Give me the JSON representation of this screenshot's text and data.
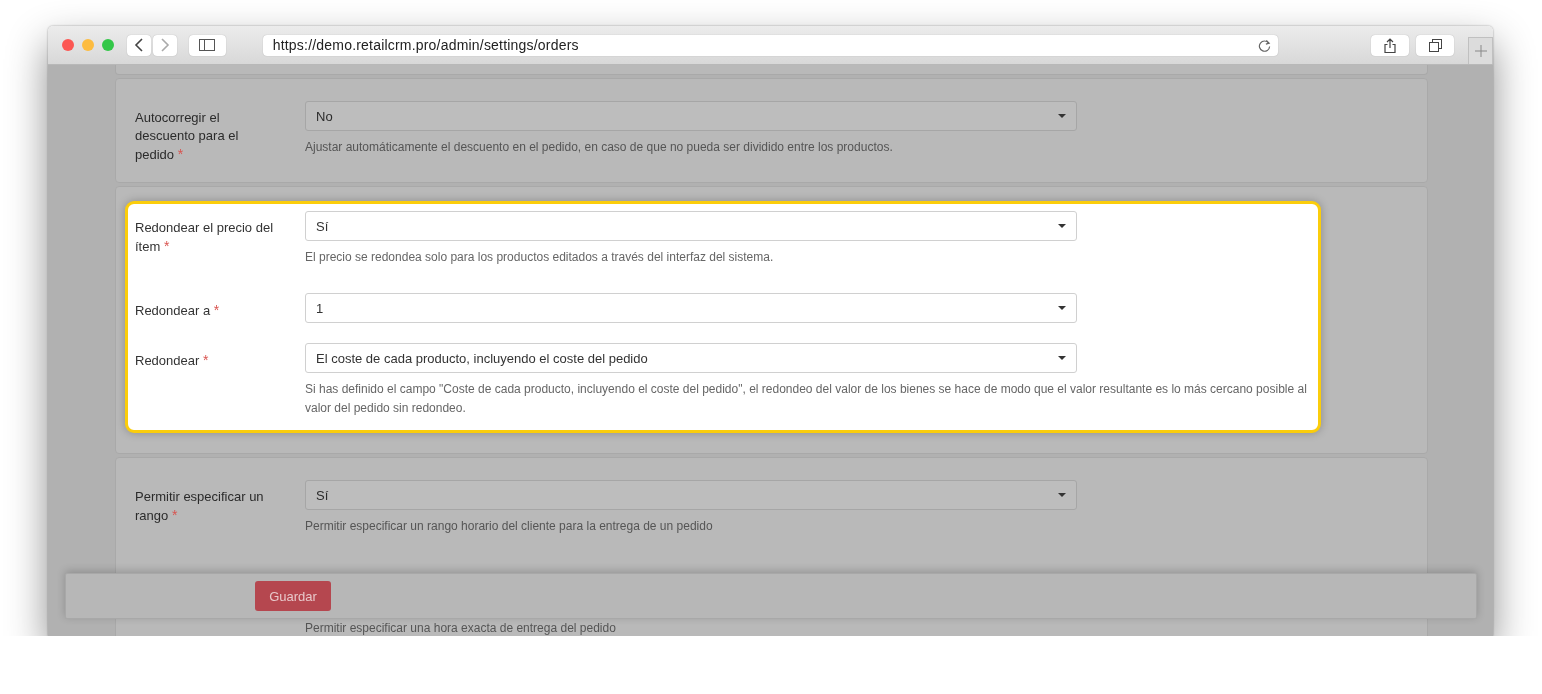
{
  "browser": {
    "url": "https://demo.retailcrm.pro/admin/settings/orders"
  },
  "sections": [
    {
      "highlighted": false,
      "rows": [
        {
          "label": "Autocorregir el descuento para el pedido",
          "required_mark": "*",
          "value": "No",
          "help": "Ajustar automáticamente el descuento en el pedido, en caso de que no pueda ser dividido entre los productos."
        }
      ]
    },
    {
      "highlighted": true,
      "rows": [
        {
          "label": "Redondear el precio del ítem",
          "required_mark": "*",
          "value": "Sí",
          "help": "El precio se redondea solo para los productos editados a través del interfaz del sistema."
        },
        {
          "label": "Redondear a",
          "required_mark": "*",
          "value": "1"
        },
        {
          "label": "Redondear",
          "required_mark": "*",
          "value": "El coste de cada producto, incluyendo el coste del pedido",
          "help": "Si has definido el campo \"Coste de cada producto, incluyendo el coste del pedido\", el redondeo del valor de los bienes se hace de modo que el valor resultante es lo más cercano posible al valor del pedido sin redondeo."
        }
      ]
    },
    {
      "highlighted": false,
      "rows": [
        {
          "label": "Permitir especificar un rango",
          "required_mark": "*",
          "value": "Sí",
          "help": "Permitir especificar un rango horario del cliente para la entrega de un pedido"
        },
        {
          "help": "Permitir especificar una hora exacta de entrega del pedido"
        }
      ]
    }
  ],
  "footer": {
    "button": "Guardar"
  }
}
